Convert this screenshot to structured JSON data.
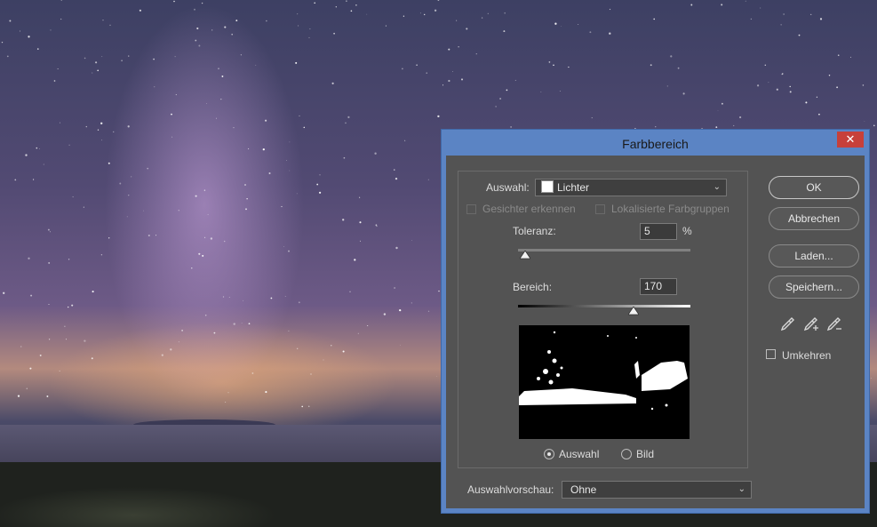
{
  "dialog": {
    "title": "Farbbereich",
    "close_glyph": "✕",
    "selection_label": "Auswahl:",
    "selection_value": "Lichter",
    "faces_label": "Gesichter erkennen",
    "localized_label": "Lokalisierte Farbgruppen",
    "tolerance_label": "Toleranz:",
    "tolerance_value": "5",
    "tolerance_unit": "%",
    "range_label": "Bereich:",
    "range_value": "170",
    "radio_selection": "Auswahl",
    "radio_image": "Bild",
    "preview_label": "Auswahlvorschau:",
    "preview_value": "Ohne",
    "buttons": {
      "ok": "OK",
      "cancel": "Abbrechen",
      "load": "Laden...",
      "save": "Speichern..."
    },
    "invert_label": "Umkehren",
    "tolerance_slider_fraction": 0.04,
    "range_slider_fraction": 0.67,
    "icons": [
      "eyedropper-icon",
      "eyedropper-plus-icon",
      "eyedropper-minus-icon"
    ],
    "colors": {
      "titlebar": "#5b84c4",
      "close": "#c7403a",
      "panel": "#535353"
    }
  }
}
